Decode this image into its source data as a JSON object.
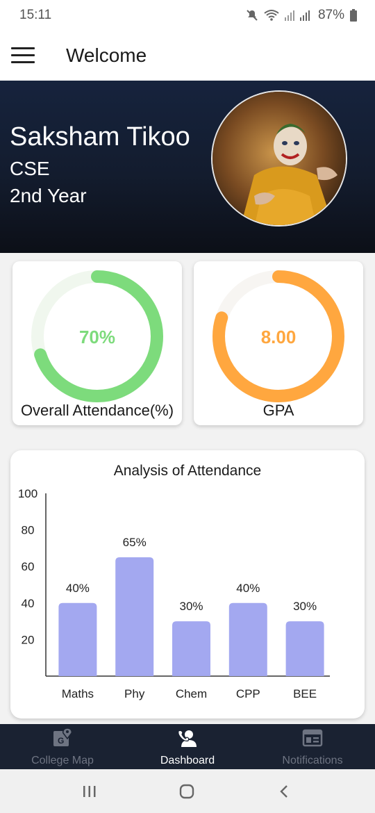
{
  "status": {
    "time": "15:11",
    "battery": "87%"
  },
  "appbar": {
    "title": "Welcome",
    "menu_icon": "hamburger-menu-icon"
  },
  "profile": {
    "name": "Saksham Tikoo",
    "branch": "CSE",
    "year": "2nd Year",
    "avatar_icon": "profile-avatar"
  },
  "stats": {
    "attendance": {
      "value_text": "70%",
      "label": "Overall Attendance(%)",
      "fraction": 0.7,
      "color": "#7ddb7c",
      "track": "#f0f7ee"
    },
    "gpa": {
      "value_text": "8.00",
      "label": "GPA",
      "fraction": 0.8,
      "color": "#ffa73f",
      "track": "#f7f5f2"
    }
  },
  "chart_data": {
    "type": "bar",
    "title": "Analysis of Attendance",
    "categories": [
      "Maths",
      "Phy",
      "Chem",
      "CPP",
      "BEE"
    ],
    "values": [
      40,
      65,
      30,
      40,
      30
    ],
    "data_labels": [
      "40%",
      "65%",
      "30%",
      "40%",
      "30%"
    ],
    "y_ticks": [
      "100",
      "80",
      "60",
      "40",
      "20"
    ],
    "ylim": [
      0,
      100
    ],
    "bar_color": "#a3a8f0",
    "grid": false
  },
  "bottom_nav": [
    {
      "label": "College Map",
      "icon": "map-pin-icon",
      "active": false
    },
    {
      "label": "Dashboard",
      "icon": "dashboard-person-icon",
      "active": true
    },
    {
      "label": "Notifications",
      "icon": "notifications-board-icon",
      "active": false
    }
  ],
  "system_nav": [
    "recents-icon",
    "home-icon",
    "back-icon"
  ]
}
